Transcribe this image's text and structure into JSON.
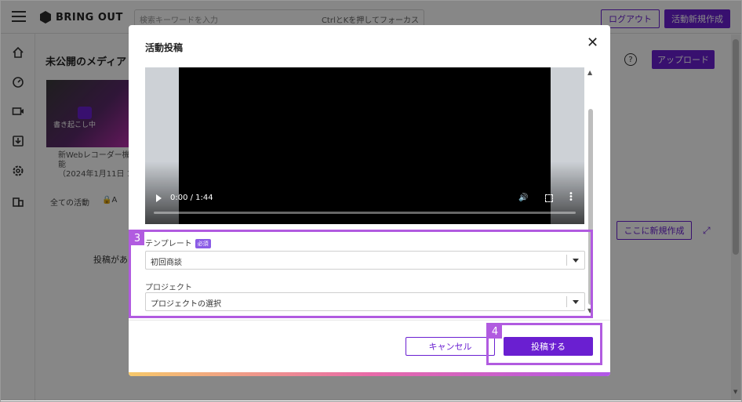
{
  "app": {
    "brand": "BRING OUT",
    "search_placeholder": "検索キーワードを入力",
    "search_hint": "CtrlとKを押してフォーカス",
    "logout_label": "ログアウト",
    "new_activity_label": "活動新規作成"
  },
  "sidebar": {
    "icons": [
      "home-icon",
      "dashboard-icon",
      "video-icon",
      "download-icon",
      "settings-icon",
      "building-icon"
    ]
  },
  "main": {
    "section_title": "未公開のメディア",
    "upload_label": "アップロード",
    "thumb_status": "書き起こし中",
    "media_name_line1": "新Webレコーダー機能",
    "media_name_line2": "（2024年1月11日 1",
    "tab_all": "全ての活動",
    "tab_locked": "A",
    "create_here_label": "ここに新規作成",
    "empty_text": "投稿があり"
  },
  "modal": {
    "title": "活動投稿",
    "video": {
      "time": "0:00 / 1:44",
      "progress": 0
    },
    "template": {
      "label": "テンプレート",
      "required_badge": "必須",
      "value": "初回商談"
    },
    "project": {
      "label": "プロジェクト",
      "value": "プロジェクトの選択"
    },
    "cancel_label": "キャンセル",
    "post_label": "投稿する"
  },
  "annotations": {
    "step3": "3",
    "step4": "4"
  },
  "colors": {
    "accent": "#6a1fd1",
    "annotation": "#b15be0"
  }
}
